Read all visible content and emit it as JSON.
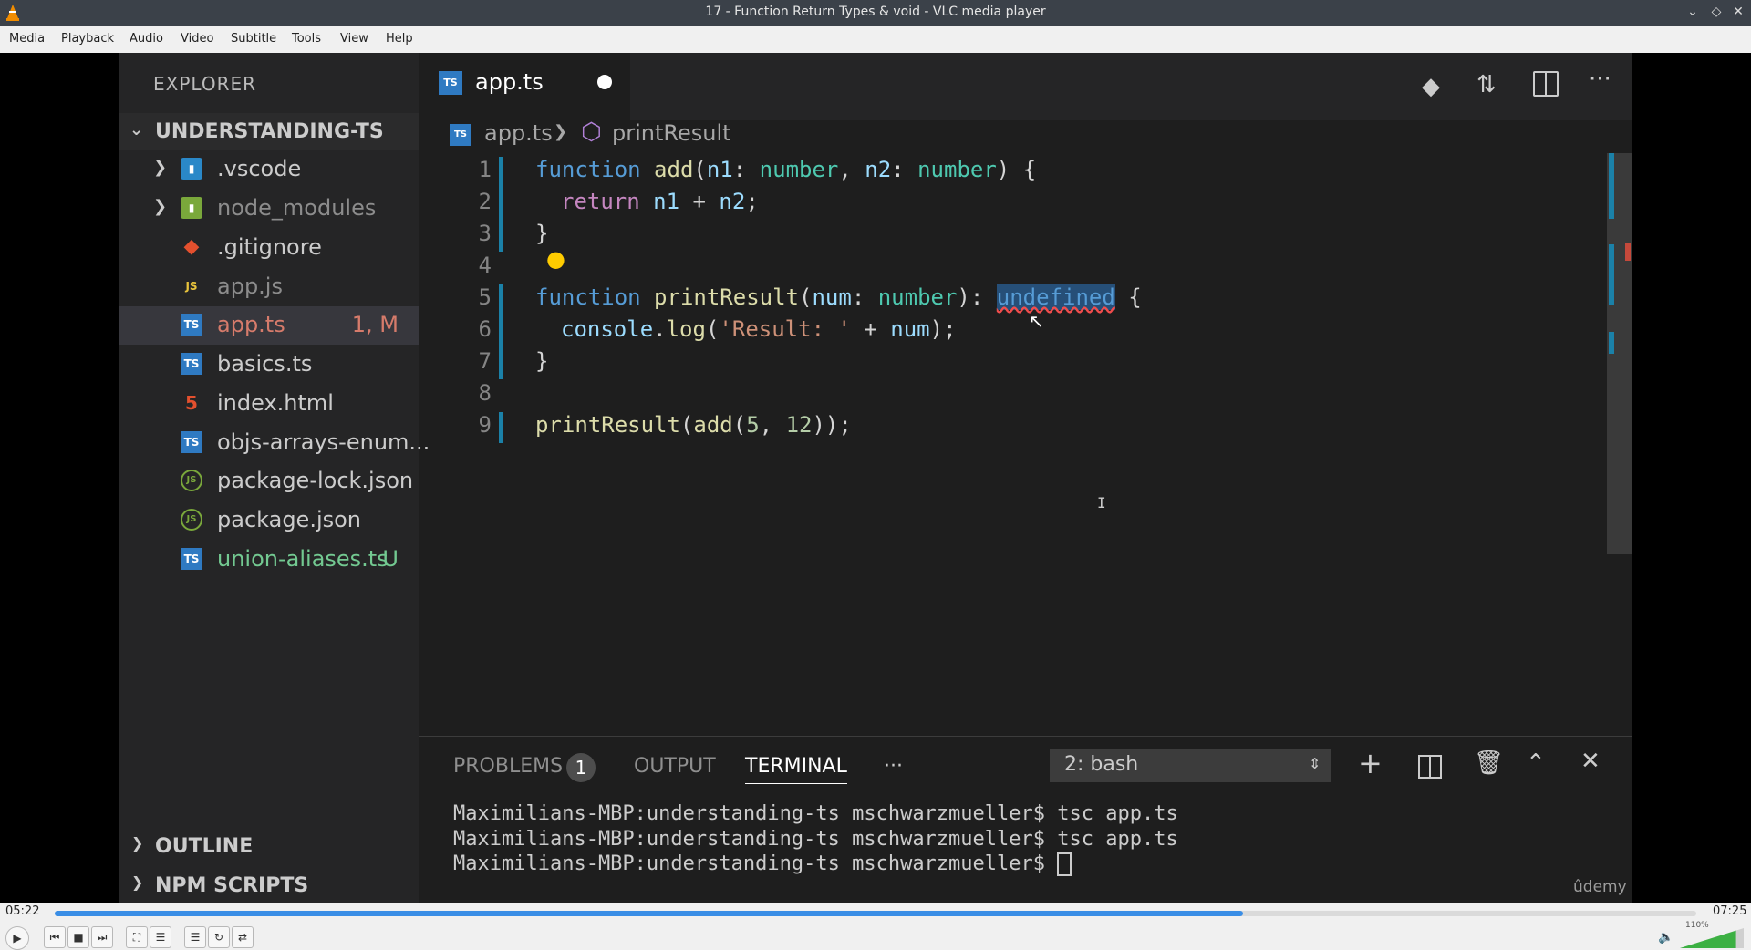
{
  "window": {
    "title": "17 - Function Return Types & void - VLC media player"
  },
  "menu": [
    "Media",
    "Playback",
    "Audio",
    "Video",
    "Subtitle",
    "Tools",
    "View",
    "Help"
  ],
  "explorer": {
    "header": "EXPLORER",
    "project": "UNDERSTANDING-TS",
    "files": [
      {
        "name": ".vscode",
        "icon": "folder-vscode-icon",
        "badge": ""
      },
      {
        "name": "node_modules",
        "icon": "folder-node-icon",
        "badge": ""
      },
      {
        "name": ".gitignore",
        "icon": "git-icon",
        "badge": ""
      },
      {
        "name": "app.js",
        "icon": "js-icon",
        "badge": ""
      },
      {
        "name": "app.ts",
        "icon": "ts-icon",
        "badge": "1, M"
      },
      {
        "name": "basics.ts",
        "icon": "ts-icon",
        "badge": ""
      },
      {
        "name": "index.html",
        "icon": "html-icon",
        "badge": ""
      },
      {
        "name": "objs-arrays-enum...",
        "icon": "ts-icon",
        "badge": ""
      },
      {
        "name": "package-lock.json",
        "icon": "node-icon",
        "badge": ""
      },
      {
        "name": "package.json",
        "icon": "node-icon",
        "badge": ""
      },
      {
        "name": "union-aliases.ts",
        "icon": "ts-icon",
        "badge": "U"
      }
    ],
    "outline": "OUTLINE",
    "npm": "NPM SCRIPTS"
  },
  "editor": {
    "tab": "app.ts",
    "breadcrumb": {
      "file": "app.ts",
      "symbol": "printResult"
    },
    "line_numbers": [
      "1",
      "2",
      "3",
      "4",
      "5",
      "6",
      "7",
      "8",
      "9"
    ],
    "code": {
      "l1": [
        "function",
        "add",
        "(",
        "n1",
        ": ",
        "number",
        ", ",
        "n2",
        ": ",
        "number",
        ") {"
      ],
      "l2": [
        "return",
        "n1",
        " + ",
        "n2",
        ";"
      ],
      "l3": "}",
      "l5": [
        "function",
        "printResult",
        "(",
        "num",
        ": ",
        "number",
        "): ",
        "undefined",
        " {"
      ],
      "l6": [
        "console",
        ".",
        "log",
        "(",
        "'Result: '",
        " + ",
        "num",
        ");"
      ],
      "l7": "}",
      "l9": [
        "printResult",
        "(",
        "add",
        "(",
        "5",
        ", ",
        "12",
        "));"
      ]
    }
  },
  "panel": {
    "tabs": {
      "problems": "PROBLEMS",
      "problems_count": "1",
      "output": "OUTPUT",
      "terminal": "TERMINAL",
      "more": "···"
    },
    "shell": "2: bash",
    "terminal_lines": [
      "Maximilians-MBP:understanding-ts mschwarzmueller$ tsc app.ts",
      "Maximilians-MBP:understanding-ts mschwarzmueller$ tsc app.ts",
      "Maximilians-MBP:understanding-ts mschwarzmueller$ "
    ],
    "watermark": "ûdemy"
  },
  "player": {
    "elapsed": "05:22",
    "total": "07:25",
    "progress": 0.724,
    "volume_label": "110%",
    "volume": 1.1
  }
}
